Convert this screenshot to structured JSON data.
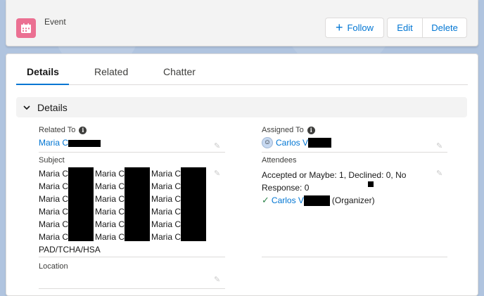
{
  "header": {
    "record_type": "Event",
    "icon": "calendar-icon",
    "follow_label": "Follow",
    "edit_label": "Edit",
    "delete_label": "Delete"
  },
  "tabs": [
    {
      "label": "Details",
      "active": true
    },
    {
      "label": "Related",
      "active": false
    },
    {
      "label": "Chatter",
      "active": false
    }
  ],
  "section": {
    "title": "Details"
  },
  "fields": {
    "related_to": {
      "label": "Related To",
      "value": "Maria C"
    },
    "assigned_to": {
      "label": "Assigned To",
      "value": "Carlos V"
    },
    "subject": {
      "label": "Subject",
      "rows": [
        "Maria C",
        "Maria C",
        "Maria C",
        "Maria C",
        "Maria C",
        "Maria C"
      ],
      "col2": [
        "Maria C",
        "Maria C",
        "Maria C",
        "Maria C",
        "Maria C",
        "Maria C"
      ],
      "col3": [
        "Maria C",
        "Maria C",
        "Maria C",
        "Maria C",
        "Maria C",
        "Maria C"
      ],
      "last_line": "PAD/TCHA/HSA"
    },
    "attendees": {
      "label": "Attendees",
      "summary_line1": "Accepted or Maybe: 1, Declined: 0, No",
      "summary_line2": "Response: 0",
      "attendee_name": "Carlos V",
      "attendee_role": "(Organizer)"
    },
    "location": {
      "label": "Location",
      "value": ""
    }
  },
  "colors": {
    "brand": "#0176d3",
    "event_icon_bg": "#eb7092",
    "success": "#2e844a"
  }
}
